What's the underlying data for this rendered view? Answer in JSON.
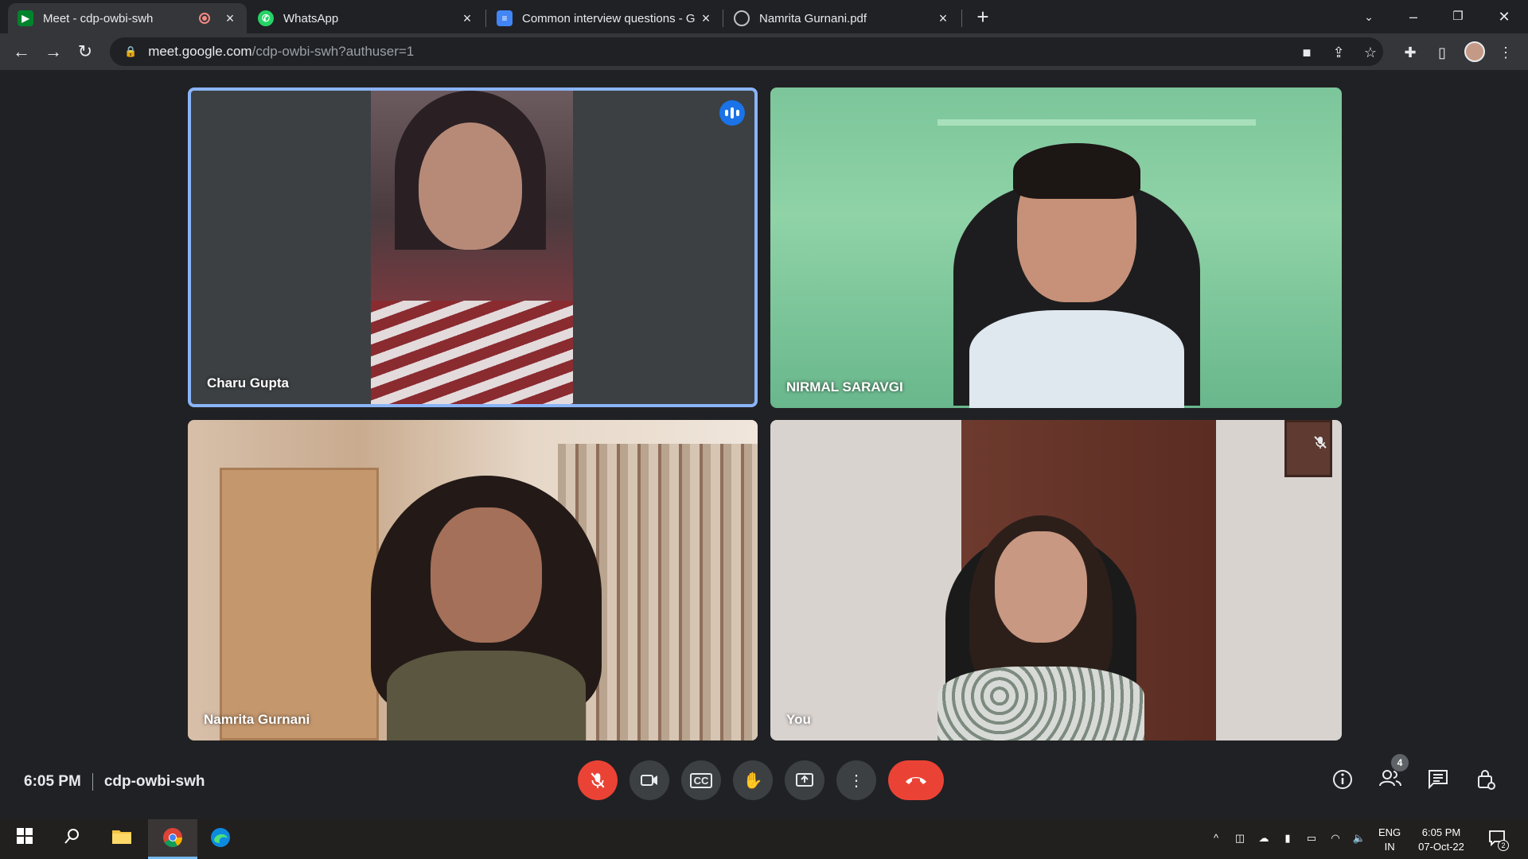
{
  "browser": {
    "tabs": [
      {
        "title": "Meet - cdp-owbi-swh",
        "icon": "google-meet-icon",
        "recording": true,
        "active": true
      },
      {
        "title": "WhatsApp",
        "icon": "whatsapp-icon",
        "active": false
      },
      {
        "title": "Common interview questions - G",
        "icon": "google-docs-icon",
        "active": false
      },
      {
        "title": "Namrita Gurnani.pdf",
        "icon": "globe-icon",
        "active": false
      }
    ],
    "url_host": "meet.google.com",
    "url_path": "/cdp-owbi-swh?authuser=1"
  },
  "meet": {
    "participants": [
      {
        "name": "Charu Gupta",
        "speaking": true
      },
      {
        "name": "NIRMAL SARAVGI"
      },
      {
        "name": "Namrita Gurnani"
      },
      {
        "name": "You",
        "muted": true
      }
    ],
    "time": "6:05 PM",
    "meeting_code": "cdp-owbi-swh",
    "people_count": "4",
    "controls": [
      "mic-off-icon",
      "camera-icon",
      "captions-icon",
      "raise-hand-icon",
      "present-screen-icon",
      "more-options-icon",
      "end-call-icon"
    ],
    "right_controls": [
      "info-icon",
      "people-icon",
      "chat-icon",
      "host-controls-icon"
    ]
  },
  "taskbar": {
    "lang_line1": "ENG",
    "lang_line2": "IN",
    "clock_time": "6:05 PM",
    "clock_date": "07-Oct-22",
    "notification_count": "2"
  },
  "colors": {
    "accent": "#8ab4f8",
    "end_call": "#ea4335",
    "background": "#202124"
  }
}
